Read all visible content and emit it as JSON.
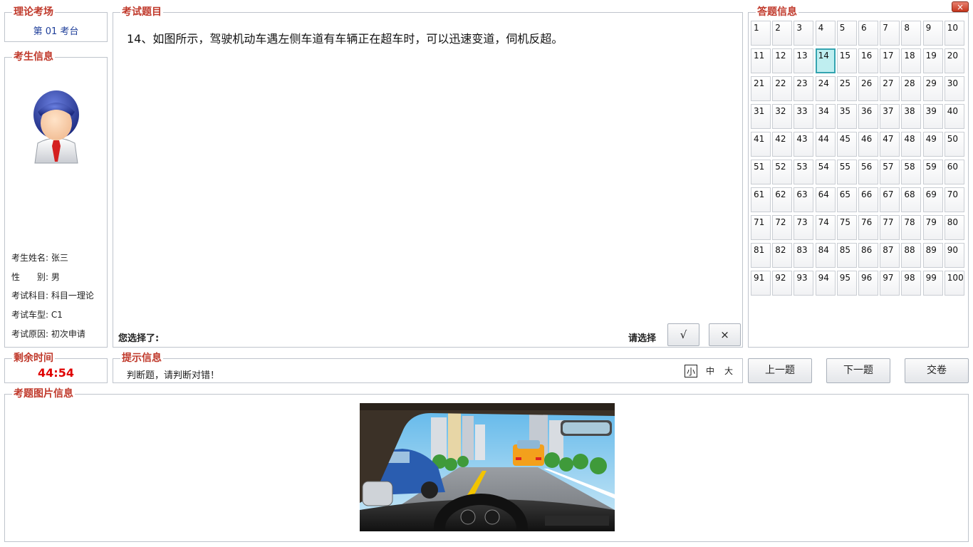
{
  "exam_hall": {
    "title": "理论考场",
    "seat": "第 01 考台"
  },
  "candidate": {
    "title": "考生信息",
    "rows": [
      {
        "label": "考生姓名:",
        "value": "张三"
      },
      {
        "label": "性　　别:",
        "value": "男"
      },
      {
        "label": "考试科目:",
        "value": "科目一理论"
      },
      {
        "label": "考试车型:",
        "value": "C1"
      },
      {
        "label": "考试原因:",
        "value": "初次申请"
      }
    ]
  },
  "question": {
    "title": "考试题目",
    "text": "14、如图所示，驾驶机动车遇左侧车道有车辆正在超车时，可以迅速变道，伺机反超。",
    "selected_label": "您选择了:",
    "choose_label": "请选择",
    "true_label": "√",
    "false_label": "×"
  },
  "answer_sheet": {
    "title": "答题信息",
    "current": 14,
    "numbers": [
      1,
      2,
      3,
      4,
      5,
      6,
      7,
      8,
      9,
      10,
      11,
      12,
      13,
      14,
      15,
      16,
      17,
      18,
      19,
      20,
      21,
      22,
      23,
      24,
      25,
      26,
      27,
      28,
      29,
      30,
      31,
      32,
      33,
      34,
      35,
      36,
      37,
      38,
      39,
      40,
      41,
      42,
      43,
      44,
      45,
      46,
      47,
      48,
      49,
      50,
      51,
      52,
      53,
      54,
      55,
      56,
      57,
      58,
      59,
      60,
      61,
      62,
      63,
      64,
      65,
      66,
      67,
      68,
      69,
      70,
      71,
      72,
      73,
      74,
      75,
      76,
      77,
      78,
      79,
      80,
      81,
      82,
      83,
      84,
      85,
      86,
      87,
      88,
      89,
      90,
      91,
      92,
      93,
      94,
      95,
      96,
      97,
      98,
      99,
      100
    ]
  },
  "timer": {
    "title": "剩余时间",
    "value": "44:54"
  },
  "hint": {
    "title": "提示信息",
    "text": "判断题，请判断对错！",
    "sizes": [
      "小",
      "中",
      "大"
    ],
    "active_size": "小"
  },
  "nav": {
    "prev": "上一题",
    "next": "下一题",
    "submit": "交卷"
  },
  "image_panel": {
    "title": "考题图片信息"
  },
  "window": {
    "close": "×"
  },
  "colors": {
    "accent": "#c0392b",
    "timer": "#e00000",
    "current_cell": "#bfeef0",
    "seat_text": "#1f3f9a"
  }
}
